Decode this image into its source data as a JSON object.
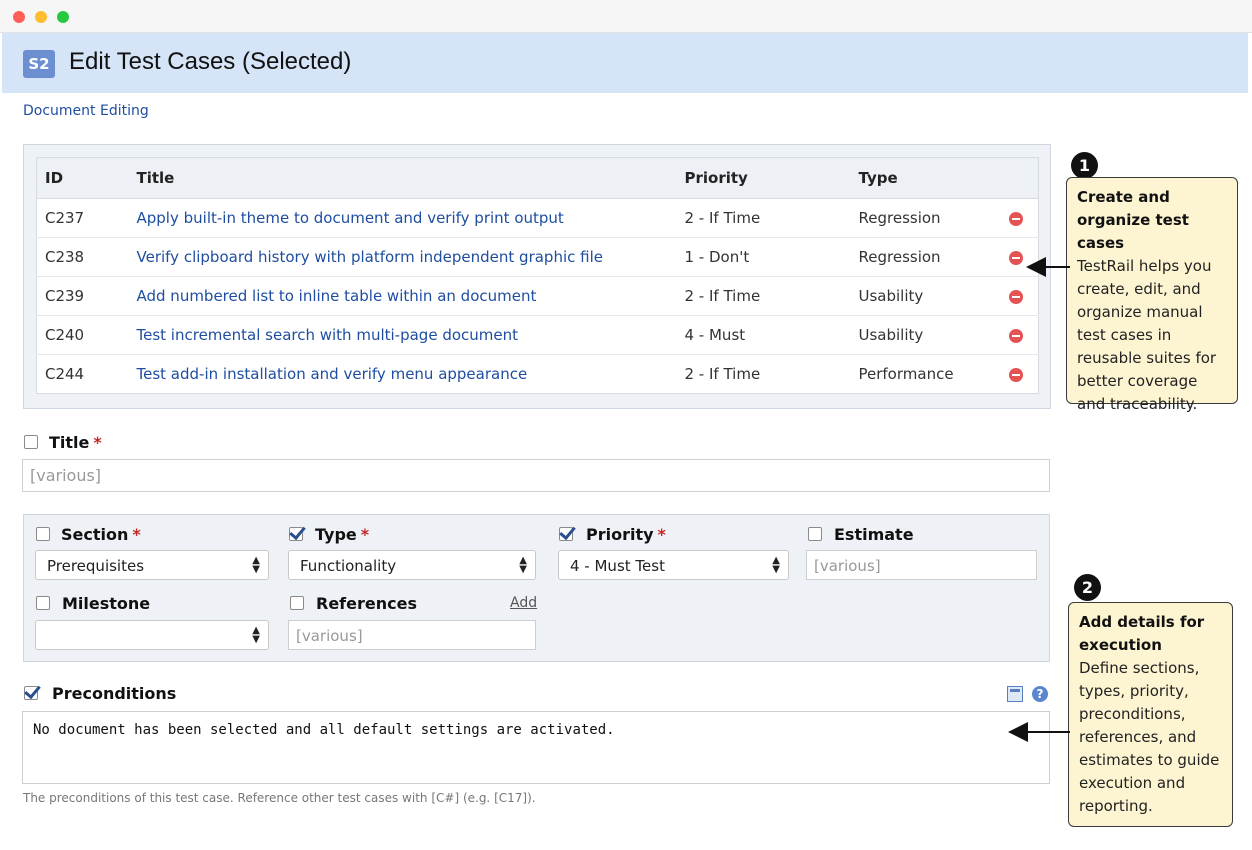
{
  "header": {
    "suite_badge": "S2",
    "title": "Edit Test Cases (Selected)"
  },
  "breadcrumb": "Document Editing",
  "table": {
    "columns": [
      "ID",
      "Title",
      "Priority",
      "Type"
    ],
    "rows": [
      {
        "id": "C237",
        "title": "Apply built-in theme to document and verify print output",
        "priority": "2 - If Time",
        "type": "Regression"
      },
      {
        "id": "C238",
        "title": "Verify clipboard history with platform independent graphic file",
        "priority": "1 - Don't",
        "type": "Regression"
      },
      {
        "id": "C239",
        "title": "Add numbered list to inline table within an document",
        "priority": "2 - If Time",
        "type": "Usability"
      },
      {
        "id": "C240",
        "title": "Test incremental search with multi-page document",
        "priority": "4 - Must",
        "type": "Usability"
      },
      {
        "id": "C244",
        "title": "Test add-in installation and verify menu appearance",
        "priority": "2 - If Time",
        "type": "Performance"
      }
    ]
  },
  "form": {
    "title_label": "Title",
    "title_value": "[various]",
    "section_label": "Section",
    "section_value": "Prerequisites",
    "type_label": "Type",
    "type_value": "Functionality",
    "priority_label": "Priority",
    "priority_value": "4 - Must Test",
    "estimate_label": "Estimate",
    "estimate_value": "[various]",
    "milestone_label": "Milestone",
    "milestone_value": "",
    "references_label": "References",
    "references_value": "[various]",
    "add_link": "Add",
    "preconditions_label": "Preconditions",
    "preconditions_value": "No document has been selected and all default settings are activated.",
    "preconditions_help": "The preconditions of this test case. Reference other test cases with [C#] (e.g. [C17]).",
    "required_mark": "*",
    "help_glyph": "?"
  },
  "callouts": [
    {
      "number": "1",
      "title": "Create and organize test cases",
      "body": "TestRail helps you create, edit, and organize manual test cases in reusable suites for better coverage and traceability."
    },
    {
      "number": "2",
      "title": "Add details for execution",
      "body": "Define sections, types, priority, preconditions, references, and estimates to guide execution and reporting."
    }
  ],
  "select_arrows": "▲\n▼"
}
